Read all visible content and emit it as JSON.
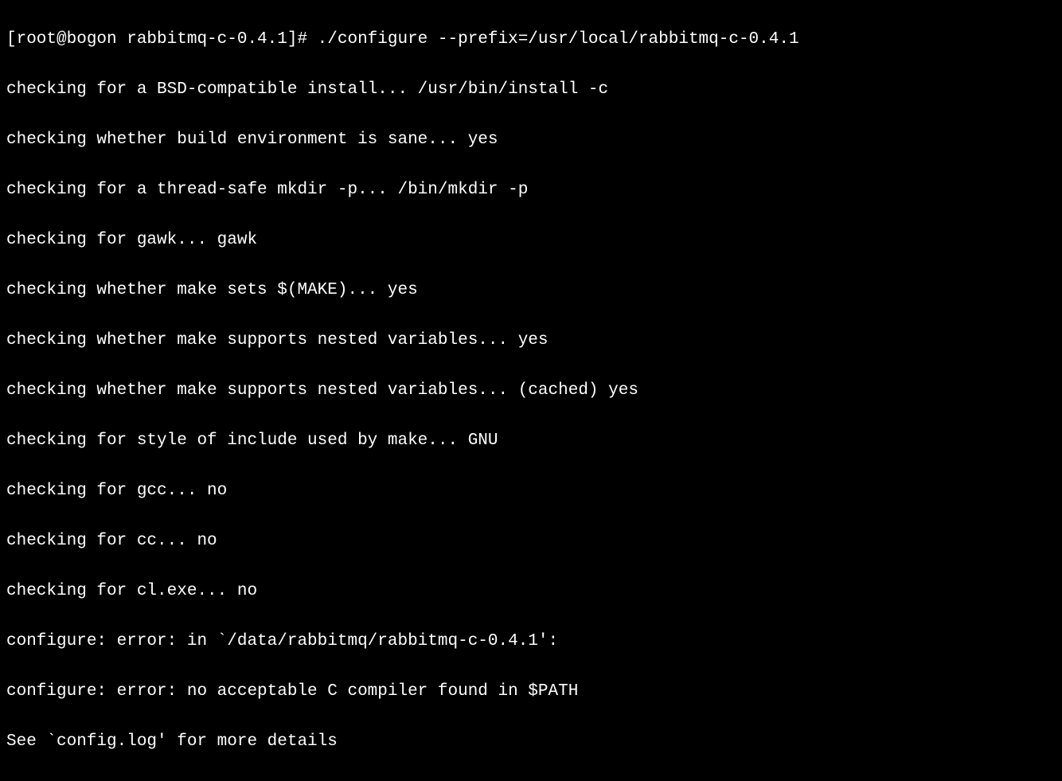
{
  "terminal": {
    "lines": [
      "[root@bogon rabbitmq-c-0.4.1]# ./configure --prefix=/usr/local/rabbitmq-c-0.4.1",
      "checking for a BSD-compatible install... /usr/bin/install -c",
      "checking whether build environment is sane... yes",
      "checking for a thread-safe mkdir -p... /bin/mkdir -p",
      "checking for gawk... gawk",
      "checking whether make sets $(MAKE)... yes",
      "checking whether make supports nested variables... yes",
      "checking whether make supports nested variables... (cached) yes",
      "checking for style of include used by make... GNU",
      "checking for gcc... no",
      "checking for cc... no",
      "checking for cl.exe... no",
      "configure: error: in `/data/rabbitmq/rabbitmq-c-0.4.1':",
      "configure: error: no acceptable C compiler found in $PATH",
      "See `config.log' for more details"
    ]
  }
}
